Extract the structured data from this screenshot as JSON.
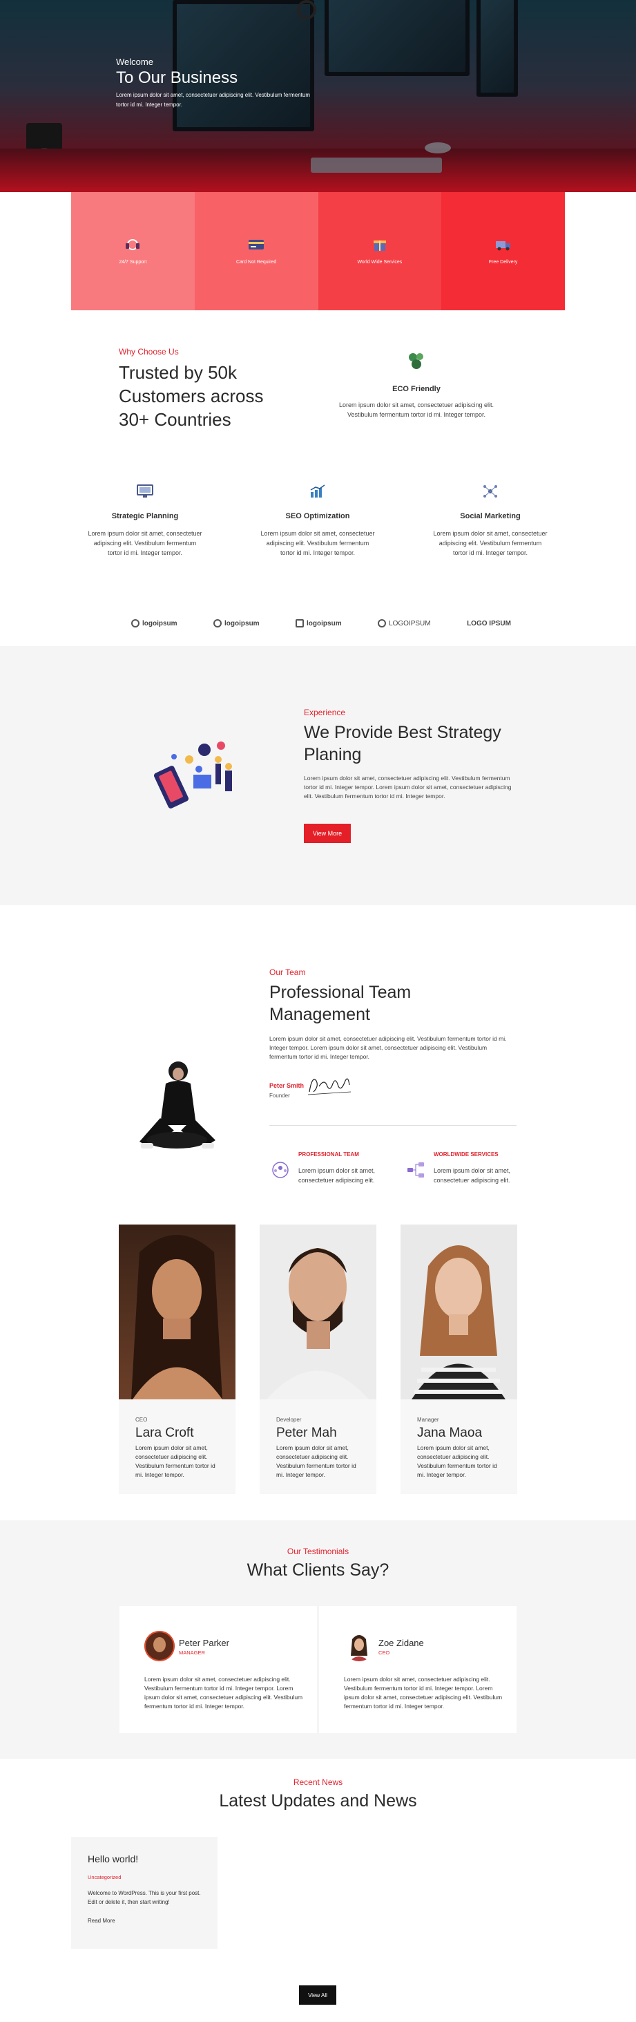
{
  "hero": {
    "welcome": "Welcome",
    "title": "To Our Business",
    "description": "Lorem ipsum dolor sit amet, consectetuer adipiscing elit. Vestibulum fermentum tortor id mi. Integer tempor."
  },
  "features": [
    {
      "label": "24/7 Support",
      "icon": "headset-icon",
      "color": "#f97a7e"
    },
    {
      "label": "Card Not Required",
      "icon": "credit-card-icon",
      "color": "#f86267"
    },
    {
      "label": "World Wide Services",
      "icon": "gift-icon",
      "color": "#f53f46"
    },
    {
      "label": "Free Delivery",
      "icon": "truck-icon",
      "color": "#f42c35"
    }
  ],
  "why": {
    "label": "Why Choose Us",
    "title": "Trusted by 50k Customers across 30+ Countries",
    "eco_icon": "leaf-icon",
    "eco_title": "ECO Friendly",
    "eco_desc": "Lorem ipsum dolor sit amet, consectetuer adipiscing elit. Vestibulum fermentum tortor id mi. Integer tempor."
  },
  "services": [
    {
      "title": "Strategic Planning",
      "icon": "monitor-icon",
      "desc": "Lorem ipsum dolor sit amet, consectetuer adipiscing elit. Vestibulum fermentum tortor id mi. Integer tempor."
    },
    {
      "title": "SEO Optimization",
      "icon": "bar-chart-icon",
      "desc": "Lorem ipsum dolor sit amet, consectetuer adipiscing elit. Vestibulum fermentum tortor id mi. Integer tempor."
    },
    {
      "title": "Social Marketing",
      "icon": "network-icon",
      "desc": "Lorem ipsum dolor sit amet, consectetuer adipiscing elit. Vestibulum fermentum tortor id mi. Integer tempor."
    }
  ],
  "logos": [
    "logoipsum",
    "logoipsum",
    "logoipsum",
    "LOGOIPSUM",
    "LOGO IPSUM"
  ],
  "experience": {
    "label": "Experience",
    "title": "We Provide Best Strategy Planing",
    "desc": "Lorem ipsum dolor sit amet, consectetuer adipiscing elit. Vestibulum fermentum tortor id mi. Integer tempor. Lorem ipsum dolor sit amet, consectetuer adipiscing elit. Vestibulum fermentum tortor id mi. Integer tempor.",
    "button": "View More"
  },
  "team": {
    "label": "Our Team",
    "title": "Professional Team Management",
    "desc": "Lorem ipsum dolor sit amet, consectetuer adipiscing elit. Vestibulum fermentum tortor id mi. Integer tempor. Lorem ipsum dolor sit amet, consectetuer adipiscing elit. Vestibulum fermentum tortor id mi. Integer tempor.",
    "founder_name": "Peter Smith",
    "founder_role": "Founder",
    "features": [
      {
        "title": "PROFESSIONAL TEAM",
        "icon": "team-icon",
        "desc": "Lorem ipsum dolor sit amet, consectetuer adipiscing elit."
      },
      {
        "title": "WORLDWIDE SERVICES",
        "icon": "hierarchy-icon",
        "desc": "Lorem ipsum dolor sit amet, consectetuer adipiscing elit."
      }
    ]
  },
  "members": [
    {
      "role": "CEO",
      "name": "Lara Croft",
      "desc": "Lorem ipsum dolor sit amet, consectetuer adipiscing elit. Vestibulum fermentum tortor id mi. Integer tempor."
    },
    {
      "role": "Developer",
      "name": "Peter Mah",
      "desc": "Lorem ipsum dolor sit amet, consectetuer adipiscing elit. Vestibulum fermentum tortor id mi. Integer tempor."
    },
    {
      "role": "Manager",
      "name": "Jana Maoa",
      "desc": "Lorem ipsum dolor sit amet, consectetuer adipiscing elit. Vestibulum fermentum tortor id mi. Integer tempor."
    }
  ],
  "testimonials": {
    "label": "Our Testimonials",
    "title": "What Clients Say?",
    "items": [
      {
        "name": "Peter Parker",
        "role": "MANAGER",
        "text": "Lorem ipsum dolor sit amet, consectetuer adipiscing elit. Vestibulum fermentum tortor id mi. Integer tempor. Lorem ipsum dolor sit amet, consectetuer adipiscing elit. Vestibulum fermentum tortor id mi. Integer tempor."
      },
      {
        "name": "Zoe Zidane",
        "role": "CEO",
        "text": "Lorem ipsum dolor sit amet, consectetuer adipiscing elit. Vestibulum fermentum tortor id mi. Integer tempor. Lorem ipsum dolor sit amet, consectetuer adipiscing elit. Vestibulum fermentum tortor id mi. Integer tempor."
      }
    ]
  },
  "news": {
    "label": "Recent News",
    "title": "Latest Updates and News",
    "post_title": "Hello world!",
    "post_category": "Uncategorized",
    "post_excerpt": "Welcome to WordPress. This is your first post. Edit or delete it, then start writing!",
    "post_more": "Read More",
    "view_all": "View All"
  },
  "colors": {
    "accent": "#e41f27",
    "dark": "#111111",
    "section_bg": "#f5f5f5"
  }
}
